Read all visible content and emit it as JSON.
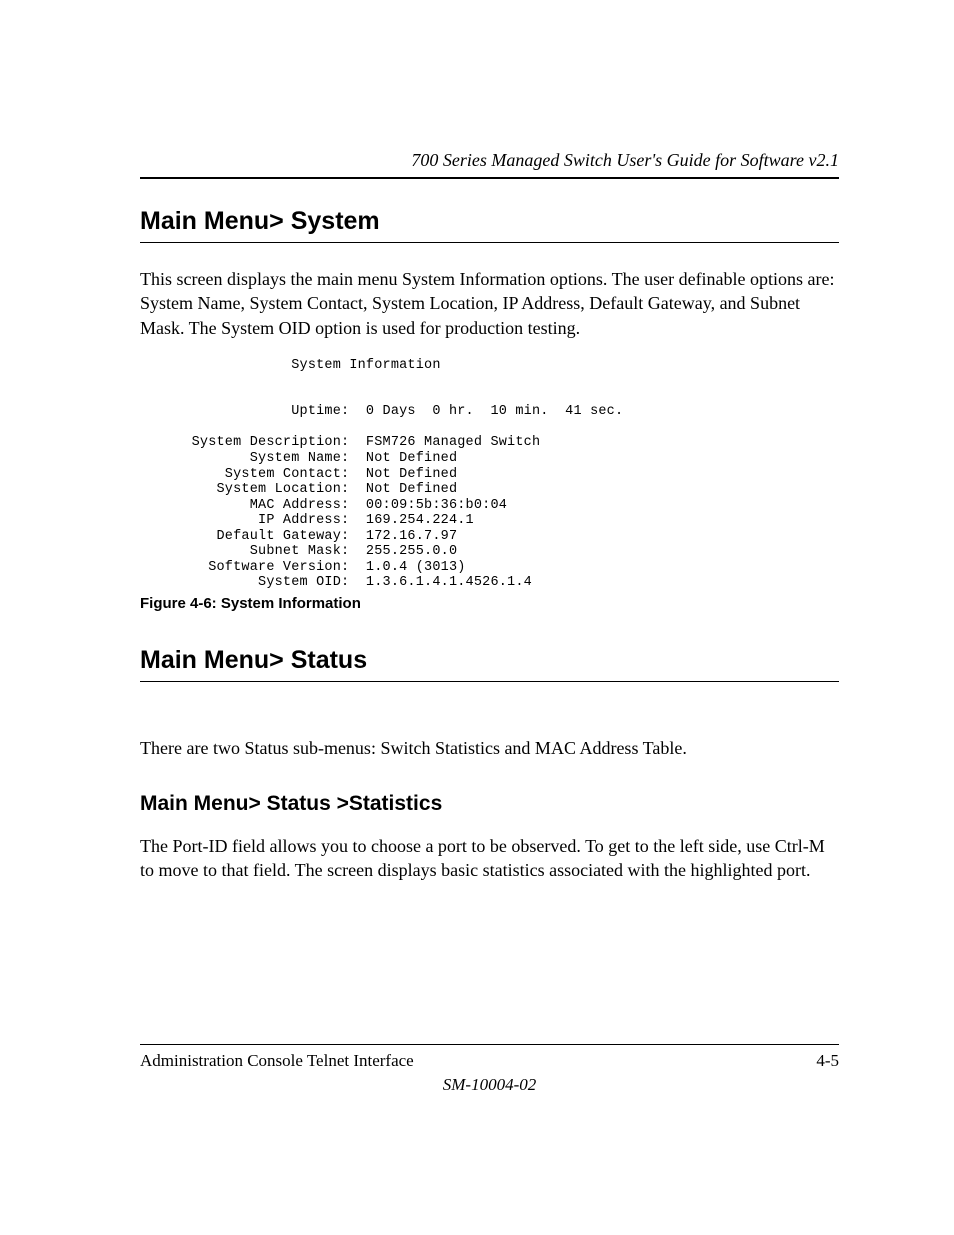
{
  "header": {
    "running_title": "700 Series Managed Switch User's Guide for Software v2.1"
  },
  "section1": {
    "heading": "Main Menu> System",
    "paragraph": "This screen displays the main menu System Information options. The user definable options are: System Name, System Contact, System Location, IP Address, Default Gateway, and Subnet Mask. The System OID option is used for production testing."
  },
  "sysinfo": {
    "title": "System Information",
    "uptime_label": "Uptime:",
    "uptime_value": "0 Days  0 hr.  10 min.  41 sec.",
    "rows": [
      {
        "label": "System Description:",
        "value": "FSM726 Managed Switch"
      },
      {
        "label": "System Name:",
        "value": "Not Defined"
      },
      {
        "label": "System Contact:",
        "value": "Not Defined"
      },
      {
        "label": "System Location:",
        "value": "Not Defined"
      },
      {
        "label": "MAC Address:",
        "value": "00:09:5b:36:b0:04"
      },
      {
        "label": "IP Address:",
        "value": "169.254.224.1"
      },
      {
        "label": "Default Gateway:",
        "value": "172.16.7.97"
      },
      {
        "label": "Subnet Mask:",
        "value": "255.255.0.0"
      },
      {
        "label": "Software Version:",
        "value": "1.0.4 (3013)"
      },
      {
        "label": "System OID:",
        "value": "1.3.6.1.4.1.4526.1.4"
      }
    ]
  },
  "figure": {
    "caption": "Figure 4-6:  System Information"
  },
  "section2": {
    "heading": "Main Menu> Status",
    "paragraph": "There are two Status sub-menus: Switch Statistics and MAC Address Table."
  },
  "section3": {
    "heading": "Main Menu> Status >Statistics",
    "paragraph": "The Port-ID field allows you to choose a port to be observed.  To get to the left side, use Ctrl-M to move to that field. The screen displays basic statistics associated with the highlighted port."
  },
  "footer": {
    "left": "Administration Console Telnet Interface",
    "right": "4-5",
    "center": "SM-10004-02"
  }
}
